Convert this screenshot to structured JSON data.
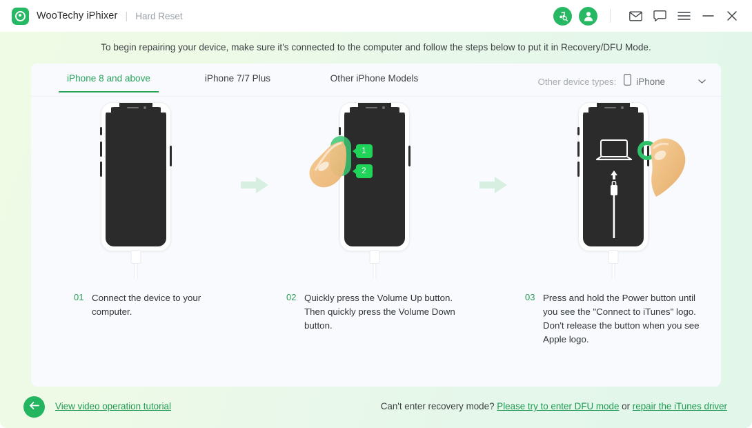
{
  "titlebar": {
    "brand": "WooTechy iPhixer",
    "separator": "|",
    "subtitle": "Hard Reset",
    "icons": {
      "itunes": "itunes-search-icon",
      "account": "account-avatar-icon",
      "mail": "mail-icon",
      "feedback": "feedback-chat-icon",
      "menu": "hamburger-menu-icon",
      "minimize": "minimize-icon",
      "close": "close-icon"
    }
  },
  "banner": {
    "text": "To begin repairing your device, make sure it's connected to the computer and follow the steps below to put it in Recovery/DFU Mode."
  },
  "tabs": [
    {
      "label": "iPhone 8 and above",
      "active": true
    },
    {
      "label": "iPhone 7/7 Plus",
      "active": false
    },
    {
      "label": "Other iPhone Models",
      "active": false
    }
  ],
  "device_select": {
    "label": "Other device types:",
    "value": "iPhone",
    "icon": "phone-outline-icon",
    "caret": "chevron-down-icon"
  },
  "steps": [
    {
      "num": "01",
      "text": "Connect the device to your computer.",
      "illustration": "iphone-connected-to-cable"
    },
    {
      "num": "02",
      "text": "Quickly press the Volume Up button. Then quickly press the Volume Down button.",
      "illustration": "iphone-pressing-volume-buttons",
      "badges": [
        "1",
        "2"
      ]
    },
    {
      "num": "03",
      "text": "Press and hold the Power button until you see the \"Connect to iTunes\" logo. Don't release the button when you see Apple logo.",
      "illustration": "iphone-connect-to-itunes-screen"
    }
  ],
  "footer": {
    "back_icon": "arrow-left-icon",
    "tutorial_link": "View video operation tutorial",
    "help_prefix": "Can't enter recovery mode?",
    "dfu_link": "Please try to enter DFU mode",
    "help_mid": "or",
    "driver_link": "repair the iTunes driver"
  },
  "colors": {
    "brand_green": "#27b863",
    "accent_green": "#2a9b55",
    "badge_green": "#20d45a",
    "arrow_green": "#d7efe0",
    "card_bg": "#f8fafd",
    "screen_dark": "#2b2b2b"
  }
}
